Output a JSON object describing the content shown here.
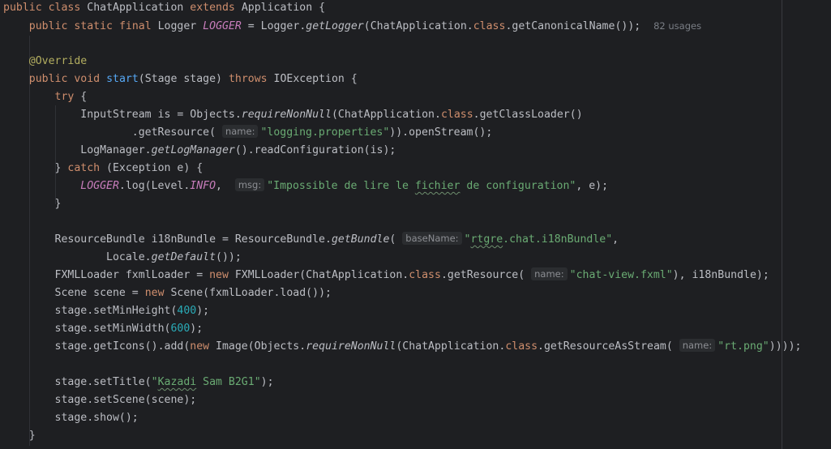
{
  "tokens": {
    "public": "public",
    "class": "class",
    "extends": "extends",
    "static": "static",
    "final": "final",
    "void": "void",
    "throws": "throws",
    "try": "try",
    "catch": "catch",
    "new": "new",
    "dot_class": "class"
  },
  "code": {
    "ChatApplication": "ChatApplication",
    "Application": "Application",
    "Logger": "Logger",
    "LOGGER": "LOGGER",
    "getLogger": "getLogger",
    "getCanonicalName": "getCanonicalName",
    "Override": "@Override",
    "start": "start",
    "Stage_stage": "(Stage stage) ",
    "IOException": "IOException",
    "InputStream_is": "InputStream is = Objects.",
    "requireNonNull": "requireNonNull",
    "getClassLoader": "getClassLoader",
    "getResource": "getResource",
    "logging_properties": "\"logging.properties\"",
    "openStream": ")).openStream();",
    "LogManager": "LogManager.",
    "getLogManager": "getLogManager",
    "readConfiguration": "().readConfiguration(is);",
    "Exception_e": " (Exception e) {",
    "log_call": ".log(Level.",
    "INFO": "INFO",
    "msg_pre": "\"Impossible de lire le ",
    "msg_typo": "fichier",
    "msg_post": " de configuration\"",
    "ResourceBundle_decl": "ResourceBundle i18nBundle = ResourceBundle.",
    "getBundle": "getBundle",
    "bundle_q1": "\"",
    "bundle_typo": "rtgre",
    "bundle_rest": ".chat.i18nBundle\"",
    "Locale": "Locale.",
    "getDefault": "getDefault",
    "FXMLLoader_decl": "FXMLLoader fxmlLoader = ",
    "FXMLLoader_ctor": " FXMLLoader(ChatApplication.",
    "chat_view": "\"chat-view.fxml\"",
    "i18nBundle_end": "), i18nBundle);",
    "Scene_decl": "Scene scene = ",
    "Scene_ctor": " Scene(fxmlLoader.load());",
    "setMinHeight": "stage.setMinHeight(",
    "min_height": "400",
    "setMinWidth": "stage.setMinWidth(",
    "min_width": "600",
    "getIcons": "stage.getIcons().add(",
    "Image_ctor": " Image(Objects.",
    "ChatApp_open": "(ChatApplication.",
    "getResourceAsStream": ".getResourceAsStream(",
    "rt_png": "\"rt.png\"",
    "close_4": "))));",
    "setTitle": "stage.setTitle(",
    "title_q1": "\"",
    "title_typo": "Kazadi",
    "title_mid": " Sam ",
    "title_typo2": "B2G1",
    "title_q2": "\"",
    "setScene": "stage.setScene(scene);",
    "show": "stage.show();",
    "close_brace": "}"
  },
  "hints": {
    "name": "name:",
    "msg": "msg:",
    "baseName": "baseName:"
  },
  "usages": "82 usages"
}
